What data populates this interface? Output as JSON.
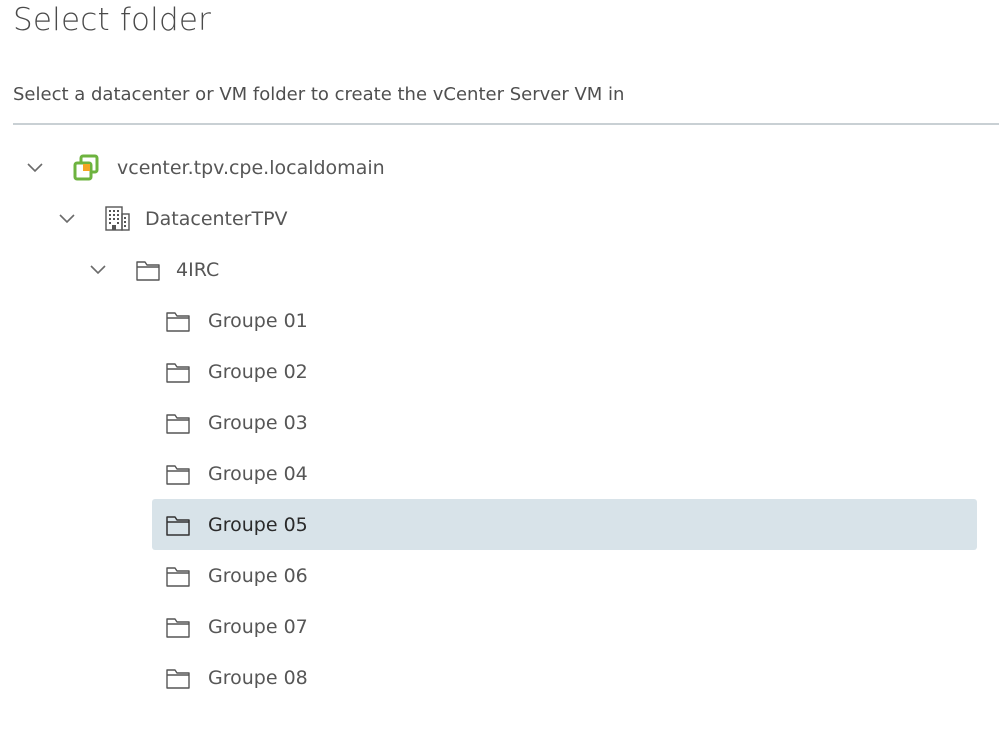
{
  "page": {
    "title": "Select folder",
    "subtitle": "Select a datacenter or VM folder to create the vCenter Server VM in"
  },
  "tree": {
    "vcenter": {
      "label": "vcenter.tpv.cpe.localdomain",
      "icon": "vcenter-icon",
      "expanded": true
    },
    "datacenter": {
      "label": "DatacenterTPV",
      "icon": "datacenter-icon",
      "expanded": true
    },
    "folder": {
      "label": "4IRC",
      "icon": "folder-icon",
      "expanded": true
    },
    "groups": [
      {
        "label": "Groupe 01",
        "icon": "folder-icon",
        "selected": false
      },
      {
        "label": "Groupe 02",
        "icon": "folder-icon",
        "selected": false
      },
      {
        "label": "Groupe 03",
        "icon": "folder-icon",
        "selected": false
      },
      {
        "label": "Groupe 04",
        "icon": "folder-icon",
        "selected": false
      },
      {
        "label": "Groupe 05",
        "icon": "folder-icon",
        "selected": true
      },
      {
        "label": "Groupe 06",
        "icon": "folder-icon",
        "selected": false
      },
      {
        "label": "Groupe 07",
        "icon": "folder-icon",
        "selected": false
      },
      {
        "label": "Groupe 08",
        "icon": "folder-icon",
        "selected": false
      }
    ]
  },
  "colors": {
    "selection": "#d8e3e9",
    "divider": "#c9d0d4",
    "vcenter_green": "#6db33f",
    "vcenter_orange": "#f5a623"
  }
}
